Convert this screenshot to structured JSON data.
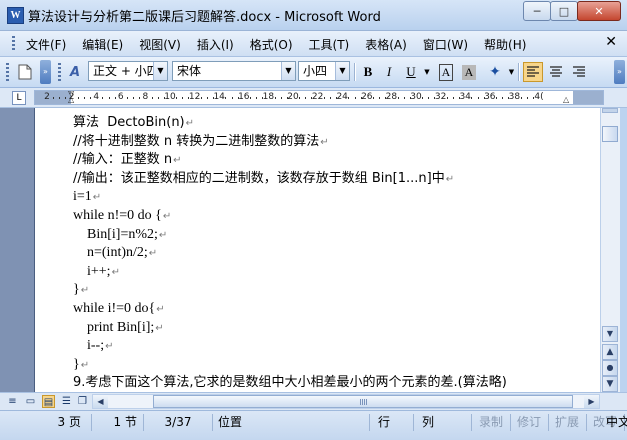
{
  "window": {
    "title": "算法设计与分析第二版课后习题解答.docx - Microsoft Word",
    "app_icon": "W",
    "minimize_label": "─",
    "maximize_label": "□",
    "close_label": "✕"
  },
  "menu": {
    "items": [
      "文件(F)",
      "编辑(E)",
      "视图(V)",
      "插入(I)",
      "格式(O)",
      "工具(T)",
      "表格(A)",
      "窗口(W)",
      "帮助(H)"
    ],
    "close_label": "✕"
  },
  "toolbar": {
    "style_combo": "正文 + 小四",
    "font_combo": "宋体",
    "size_combo": "小四",
    "bold": "B",
    "italic": "I",
    "underline": "U",
    "style_icon": "A",
    "char_border": "A",
    "char_shading": "A"
  },
  "ruler": {
    "corner": "L",
    "numbers": [
      "2",
      "2",
      "4",
      "6",
      "8",
      "10",
      "12",
      "14",
      "16",
      "18",
      "20",
      "22",
      "24",
      "26",
      "28",
      "30",
      "32",
      "34",
      "36",
      "38",
      "4("
    ]
  },
  "document": {
    "lines": [
      {
        "text": "算法  DectoBin(n)",
        "indent": 0
      },
      {
        "text": "//将十进制整数 n 转换为二进制整数的算法",
        "indent": 0
      },
      {
        "text": "//输入：正整数 n",
        "indent": 0
      },
      {
        "text": "//输出：该正整数相应的二进制数，该数存放于数组 Bin[1...n]中",
        "indent": 0
      },
      {
        "text": "i=1",
        "indent": 0
      },
      {
        "text": "while n!=0 do {",
        "indent": 0
      },
      {
        "text": "Bin[i]=n%2;",
        "indent": 1
      },
      {
        "text": "n=(int)n/2;",
        "indent": 1
      },
      {
        "text": "i++;",
        "indent": 1
      },
      {
        "text": "}",
        "indent": 0
      },
      {
        "text": "while i!=0 do{",
        "indent": 0
      },
      {
        "text": "print Bin[i];",
        "indent": 1
      },
      {
        "text": "i--;",
        "indent": 1
      },
      {
        "text": "}",
        "indent": 0
      }
    ],
    "last_line": "9.考虑下面这个算法,它求的是数组中大小相差最小的两个元素的差.(算法略)",
    "paragraph_mark": "↵"
  },
  "status": {
    "page": "3 页",
    "section": "1 节",
    "page_of": "3/37",
    "position": "位置",
    "line": "行",
    "column": "列",
    "rec": "录制",
    "trk": "修订",
    "ext": "扩展",
    "ovr": "改写",
    "lang": "中文"
  }
}
